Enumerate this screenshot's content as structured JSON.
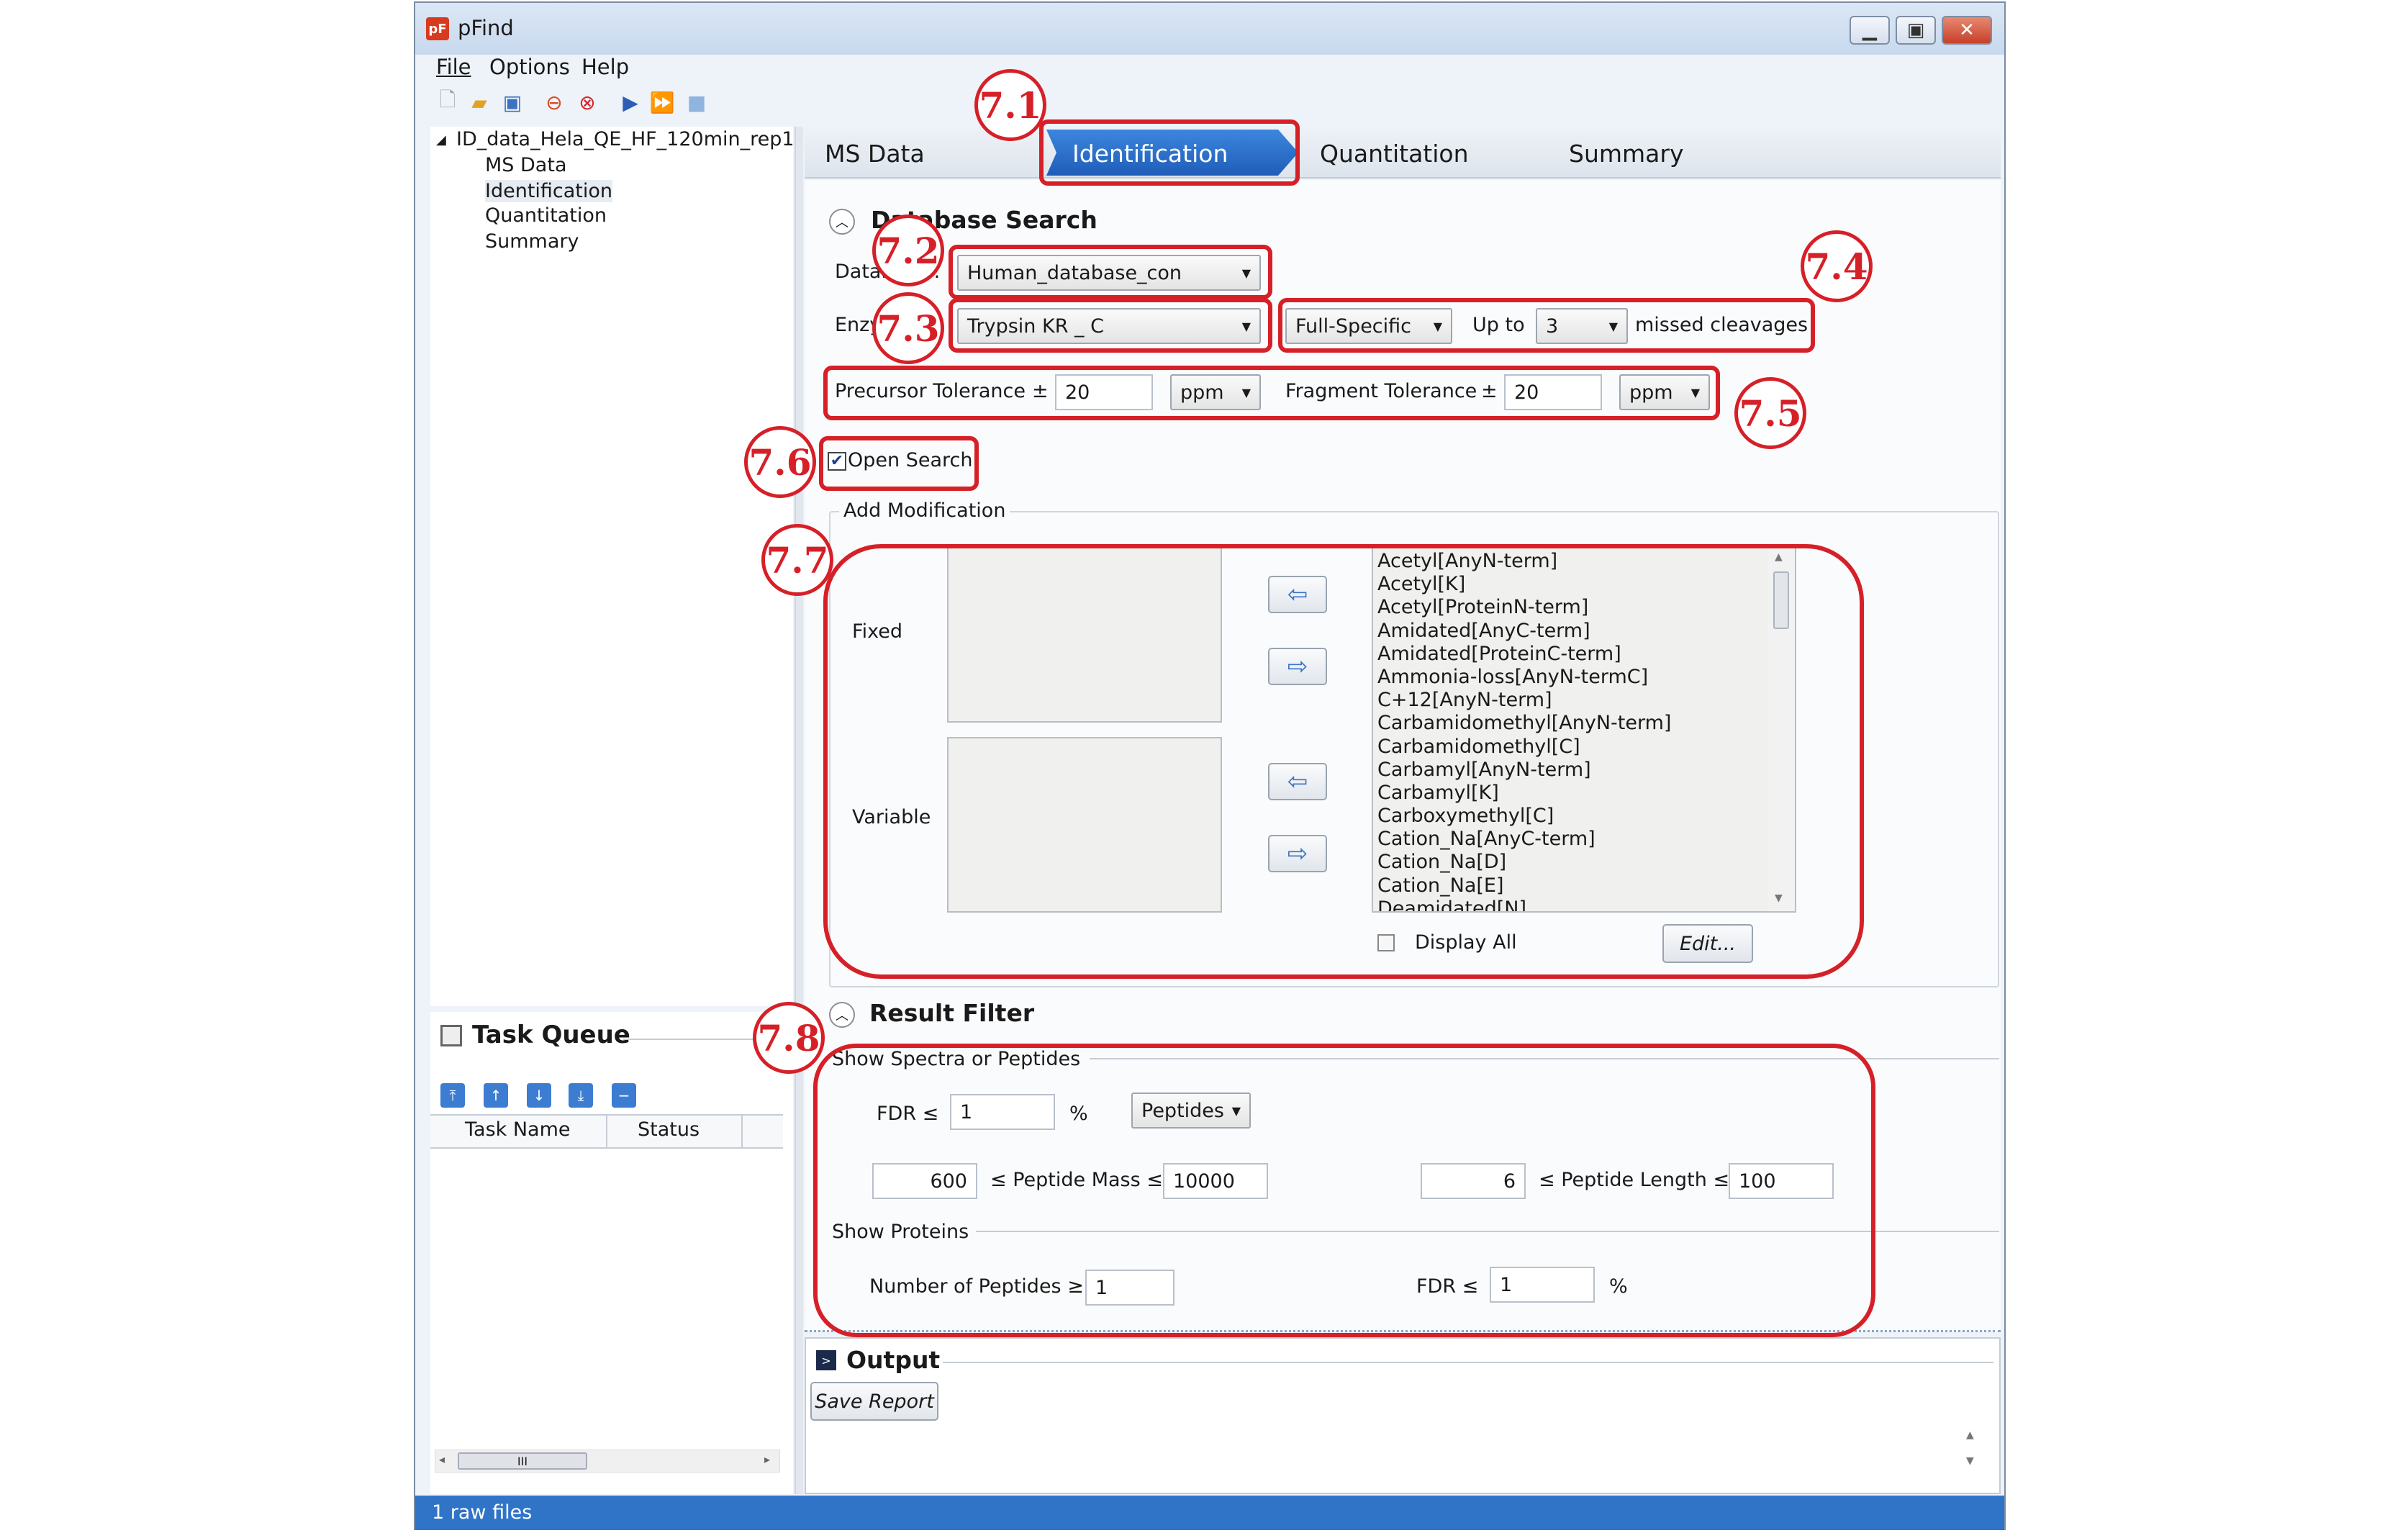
{
  "window": {
    "title": "pFind",
    "app_icon": "pF"
  },
  "menu": [
    "File",
    "Options",
    "Help"
  ],
  "toolbar_icons": [
    "new-file-icon",
    "open-folder-icon",
    "save-icon",
    "stop-icon",
    "cancel-icon",
    "run-icon",
    "run-all-icon",
    "stop-square-icon"
  ],
  "tree": {
    "root": "ID_data_Hela_QE_HF_120min_rep1",
    "children": [
      "MS Data",
      "Identification",
      "Quantitation",
      "Summary"
    ]
  },
  "tabs": [
    "MS Data",
    "Identification",
    "Quantitation",
    "Summary"
  ],
  "annotations": [
    "7.1",
    "7.2",
    "7.3",
    "7.4",
    "7.5",
    "7.6",
    "7.7",
    "7.8"
  ],
  "database_search": {
    "title": "Database Search",
    "database_label": "Database :",
    "database_value": "Human_database_con",
    "enzyme_label": "Enzyme",
    "enzyme_value": "Trypsin KR _ C",
    "specificity": "Full-Specific",
    "up_to_label": "Up to",
    "missed_value": "3",
    "missed_label": "missed cleavages",
    "precursor_label": "Precursor Tolerance",
    "pm": "±",
    "precursor_value": "20",
    "precursor_unit": "ppm",
    "fragment_label": "Fragment Tolerance",
    "fragment_value": "20",
    "fragment_unit": "ppm",
    "open_search_label": "Open Search",
    "open_search_checked": true
  },
  "modification": {
    "group_title": "Add Modification",
    "fixed_label": "Fixed",
    "variable_label": "Variable",
    "list": [
      "Acetyl[AnyN-term]",
      "Acetyl[K]",
      "Acetyl[ProteinN-term]",
      "Amidated[AnyC-term]",
      "Amidated[ProteinC-term]",
      "Ammonia-loss[AnyN-termC]",
      "C+12[AnyN-term]",
      "Carbamidomethyl[AnyN-term]",
      "Carbamidomethyl[C]",
      "Carbamyl[AnyN-term]",
      "Carbamyl[K]",
      "Carboxymethyl[C]",
      "Cation_Na[AnyC-term]",
      "Cation_Na[D]",
      "Cation_Na[E]",
      "Deamidated[N]"
    ],
    "display_all_label": "Display All",
    "edit_label": "Edit..."
  },
  "result_filter": {
    "title": "Result Filter",
    "spectra_group": "Show Spectra or Peptides",
    "fdr_label": "FDR ≤",
    "fdr_value": "1",
    "percent": "%",
    "level": "Peptides",
    "mass_min": "600",
    "mass_label": "≤ Peptide Mass ≤",
    "mass_max": "10000",
    "len_min": "6",
    "len_label": "≤ Peptide Length ≤",
    "len_max": "100",
    "proteins_group": "Show Proteins",
    "num_peptides_label": "Number of Peptides ≥",
    "num_peptides_value": "1",
    "protein_fdr_label": "FDR ≤",
    "protein_fdr_value": "1",
    "protein_percent": "%"
  },
  "task_queue": {
    "title": "Task Queue",
    "columns": [
      "Task Name",
      "Status"
    ],
    "scroll_glyph": "III"
  },
  "output": {
    "title": "Output",
    "save_label": "Save Report"
  },
  "status_bar": {
    "text": "1 raw files"
  },
  "colors": {
    "annotation_red": "#d62028",
    "tab_active": "#2d6fc4",
    "status_bar": "#2f74c7"
  }
}
